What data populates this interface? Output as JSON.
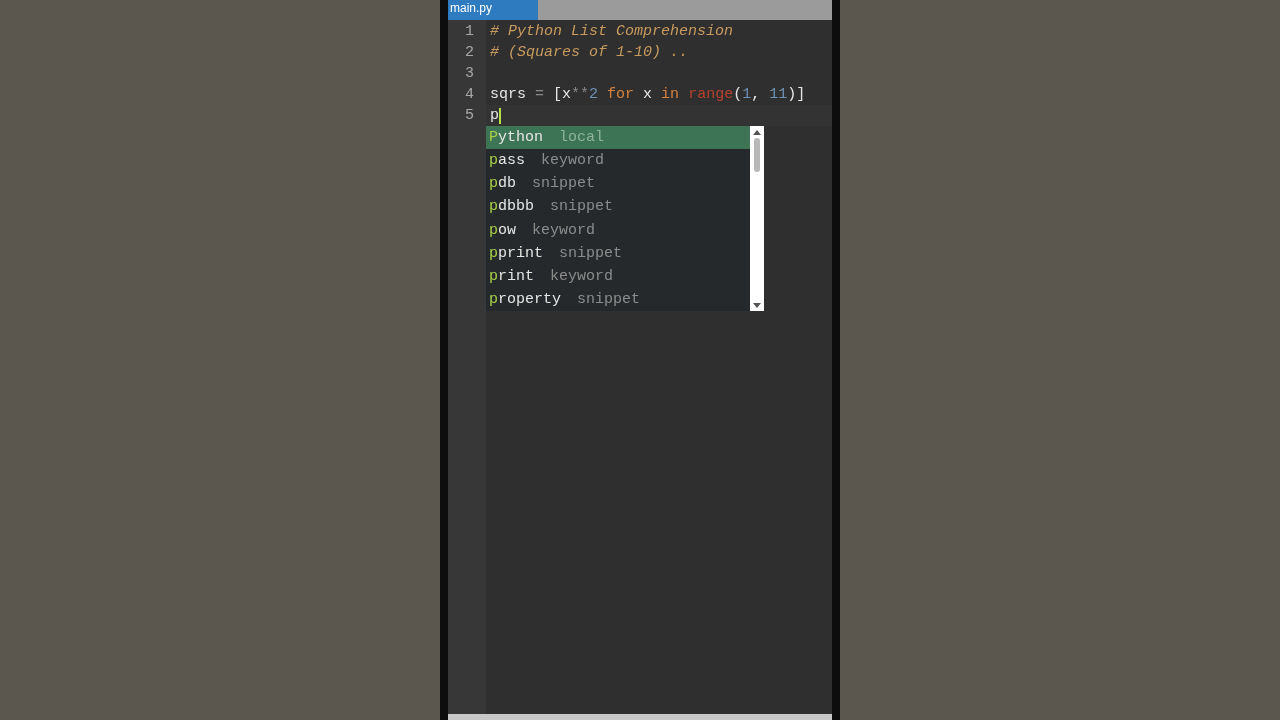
{
  "tabs": [
    {
      "label": "main.py",
      "selected": true
    }
  ],
  "editor": {
    "lines": [
      {
        "number": "1",
        "current": false,
        "tokens": [
          {
            "kind": "comment",
            "text": "# Python List Comprehension"
          }
        ]
      },
      {
        "number": "2",
        "current": false,
        "tokens": [
          {
            "kind": "comment",
            "text": "# (Squares of 1-10) .."
          }
        ]
      },
      {
        "number": "3",
        "current": false
      },
      {
        "number": "4",
        "current": false,
        "tokens": [
          {
            "kind": "plain",
            "text": "sqrs"
          },
          {
            "kind": "operator",
            "text": " = "
          },
          {
            "kind": "plain",
            "text": "[x"
          },
          {
            "kind": "operator",
            "text": "**"
          },
          {
            "kind": "number",
            "text": "2"
          },
          {
            "kind": "keyword",
            "text": " for"
          },
          {
            "kind": "plain",
            "text": " x"
          },
          {
            "kind": "keyword",
            "text": " in"
          },
          {
            "kind": "builtin",
            "text": " range"
          },
          {
            "kind": "plain",
            "text": "("
          },
          {
            "kind": "number",
            "text": "1"
          },
          {
            "kind": "plain",
            "text": ", "
          },
          {
            "kind": "number",
            "text": "11"
          },
          {
            "kind": "plain",
            "text": ")]"
          }
        ]
      },
      {
        "number": "5",
        "current": true,
        "tokens": [
          {
            "kind": "plain",
            "text": "p"
          }
        ]
      }
    ]
  },
  "autocomplete": {
    "items": [
      {
        "match": "P",
        "rest": "ython",
        "type": "local",
        "selected": true
      },
      {
        "match": "p",
        "rest": "ass",
        "type": "keyword",
        "selected": false
      },
      {
        "match": "p",
        "rest": "db",
        "type": "snippet",
        "selected": false
      },
      {
        "match": "p",
        "rest": "dbbb",
        "type": "snippet",
        "selected": false
      },
      {
        "match": "p",
        "rest": "ow",
        "type": "keyword",
        "selected": false
      },
      {
        "match": "p",
        "rest": "print",
        "type": "snippet",
        "selected": false
      },
      {
        "match": "p",
        "rest": "rint",
        "type": "keyword",
        "selected": false
      },
      {
        "match": "p",
        "rest": "roperty",
        "type": "snippet",
        "selected": false
      }
    ]
  }
}
